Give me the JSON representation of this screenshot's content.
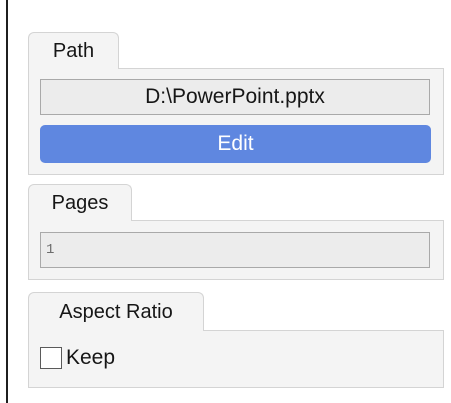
{
  "path_section": {
    "tab_label": "Path",
    "path_value": "D:\\PowerPoint.pptx",
    "edit_label": "Edit"
  },
  "pages_section": {
    "tab_label": "Pages",
    "pages_value": "1"
  },
  "aspect_ratio_section": {
    "tab_label": "Aspect Ratio",
    "keep_label": "Keep",
    "keep_checked": false
  },
  "colors": {
    "edit_button": "#5f87e0",
    "panel_background": "#f4f4f4",
    "field_background": "#ececec"
  }
}
